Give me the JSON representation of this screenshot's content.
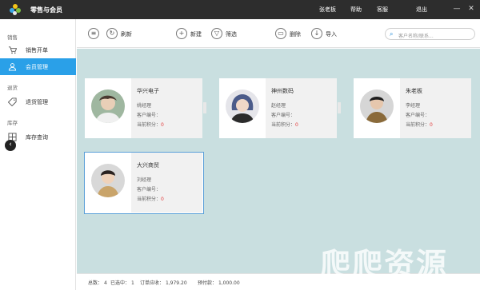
{
  "app": {
    "title": "零售与会员"
  },
  "menu": {
    "user": "张老板",
    "help": "帮助",
    "service": "客服",
    "logout": "退出"
  },
  "window": {
    "minimize": "—",
    "close": "✕"
  },
  "sidebar": {
    "sections": [
      {
        "label": "销售",
        "items": [
          {
            "label": "销售开单",
            "icon": "cart-icon"
          },
          {
            "label": "会员管理",
            "icon": "user-icon"
          }
        ]
      },
      {
        "label": "退货",
        "items": [
          {
            "label": "退货管理",
            "icon": "tag-icon"
          }
        ]
      },
      {
        "label": "库存",
        "items": [
          {
            "label": "库存查询",
            "icon": "inventory-icon"
          }
        ]
      }
    ]
  },
  "toolbar": {
    "menu_icon": "≡",
    "refresh": "刷新",
    "new": "新建",
    "filter": "筛选",
    "delete": "删除",
    "import": "导入",
    "search_placeholder": "客户名称/联系..."
  },
  "cards": [
    {
      "name": "华兴电子",
      "manager": "姚经理",
      "code_label": "客户编号：",
      "points_label": "当前积分：",
      "points": "0"
    },
    {
      "name": "神州数码",
      "manager": "赵经理",
      "code_label": "客户编号：",
      "points_label": "当前积分：",
      "points": "0"
    },
    {
      "name": "朱老板",
      "manager": "李经理",
      "code_label": "客户编号：",
      "points_label": "当前积分：",
      "points": "0"
    },
    {
      "name": "大兴商贸",
      "manager": "刘经理",
      "code_label": "客户编号：",
      "points_label": "当前积分：",
      "points": "0"
    }
  ],
  "footer": {
    "total_label": "总数：",
    "total": "4",
    "selected_label": "已选中：",
    "selected": "1",
    "receivable_label": "订单应收：",
    "receivable": "1,979.20",
    "prepaid_label": "预付款：",
    "prepaid": "1,000.00"
  },
  "watermark": "爬爬资源",
  "colors": {
    "accent": "#2aa0e8",
    "titlebar": "#2d2d2d",
    "content_bg": "#c9dfe0",
    "points": "#e23b3b"
  }
}
